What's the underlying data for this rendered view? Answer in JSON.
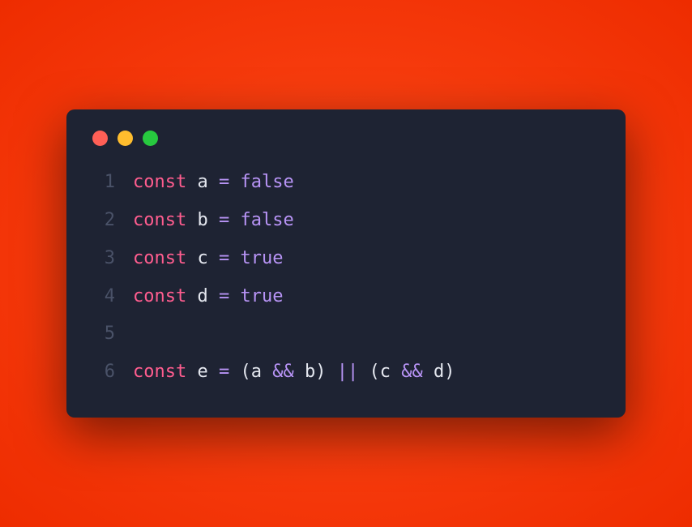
{
  "titlebar": {
    "dots": [
      "red",
      "yellow",
      "green"
    ]
  },
  "code": {
    "lines": [
      {
        "num": "1",
        "tokens": [
          {
            "cls": "keyword",
            "t": "const"
          },
          {
            "cls": "ident",
            "t": " a "
          },
          {
            "cls": "op",
            "t": "="
          },
          {
            "cls": "ident",
            "t": " "
          },
          {
            "cls": "bool",
            "t": "false"
          }
        ]
      },
      {
        "num": "2",
        "tokens": [
          {
            "cls": "keyword",
            "t": "const"
          },
          {
            "cls": "ident",
            "t": " b "
          },
          {
            "cls": "op",
            "t": "="
          },
          {
            "cls": "ident",
            "t": " "
          },
          {
            "cls": "bool",
            "t": "false"
          }
        ]
      },
      {
        "num": "3",
        "tokens": [
          {
            "cls": "keyword",
            "t": "const"
          },
          {
            "cls": "ident",
            "t": " c "
          },
          {
            "cls": "op",
            "t": "="
          },
          {
            "cls": "ident",
            "t": " "
          },
          {
            "cls": "bool",
            "t": "true"
          }
        ]
      },
      {
        "num": "4",
        "tokens": [
          {
            "cls": "keyword",
            "t": "const"
          },
          {
            "cls": "ident",
            "t": " d "
          },
          {
            "cls": "op",
            "t": "="
          },
          {
            "cls": "ident",
            "t": " "
          },
          {
            "cls": "bool",
            "t": "true"
          }
        ]
      },
      {
        "num": "5",
        "tokens": []
      },
      {
        "num": "6",
        "tokens": [
          {
            "cls": "keyword",
            "t": "const"
          },
          {
            "cls": "ident",
            "t": " e "
          },
          {
            "cls": "op",
            "t": "="
          },
          {
            "cls": "ident",
            "t": " "
          },
          {
            "cls": "paren",
            "t": "("
          },
          {
            "cls": "ident",
            "t": "a "
          },
          {
            "cls": "op",
            "t": "&&"
          },
          {
            "cls": "ident",
            "t": " b"
          },
          {
            "cls": "paren",
            "t": ")"
          },
          {
            "cls": "ident",
            "t": " "
          },
          {
            "cls": "op",
            "t": "||"
          },
          {
            "cls": "ident",
            "t": " "
          },
          {
            "cls": "paren",
            "t": "("
          },
          {
            "cls": "ident",
            "t": "c "
          },
          {
            "cls": "op",
            "t": "&&"
          },
          {
            "cls": "ident",
            "t": " d"
          },
          {
            "cls": "paren",
            "t": ")"
          }
        ]
      }
    ]
  }
}
